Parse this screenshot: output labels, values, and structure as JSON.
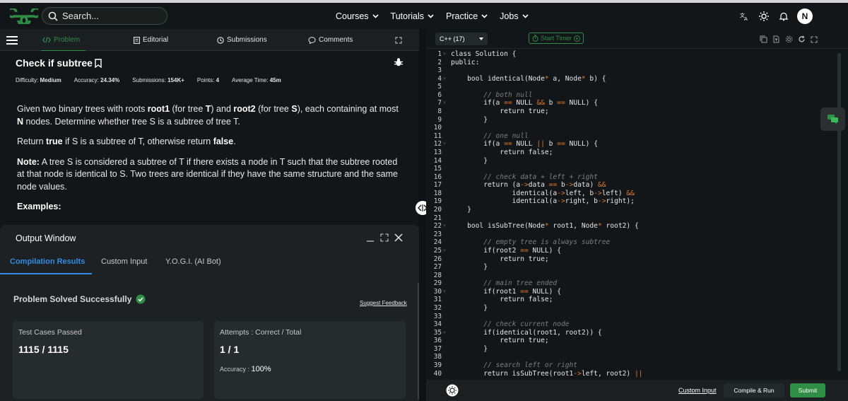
{
  "nav": {
    "search_placeholder": "Search...",
    "links": [
      "Courses",
      "Tutorials",
      "Practice",
      "Jobs"
    ],
    "avatar_initial": "N",
    "brand_color": "#2f8d46"
  },
  "tabs": [
    "Problem",
    "Editorial",
    "Submissions",
    "Comments"
  ],
  "problem": {
    "title": "Check if subtree",
    "meta": {
      "difficulty_label": "Difficulty:",
      "difficulty": "Medium",
      "accuracy_label": "Accuracy:",
      "accuracy": "24.34%",
      "submissions_label": "Submissions:",
      "submissions": "154K+",
      "points_label": "Points:",
      "points": "4",
      "time_label": "Average Time:",
      "time": "45m"
    },
    "para1": {
      "t1": "Given two binary trees with roots ",
      "b1": "root1",
      "t2": " (for tree ",
      "b2": "T",
      "t3": ") and ",
      "b3": "root2",
      "t4": " (for tree ",
      "b4": "S",
      "t5": "), each containing at most ",
      "b5": "N",
      "t6": " nodes. Determine whether tree S is a subtree of tree T."
    },
    "para2": {
      "t1": "Return ",
      "b1": "true",
      "t2": " if S is a subtree of T, otherwise return ",
      "b2": "false",
      "t3": "."
    },
    "para3": {
      "b1": "Note:",
      "t1": " A tree S is considered a subtree of T if there exists a node in T such that the subtree rooted at that node is identical to S. Two trees are identical if they have the same structure and the same node values."
    },
    "examples_label": "Examples:"
  },
  "output": {
    "title": "Output Window",
    "tabs": [
      "Compilation Results",
      "Custom Input",
      "Y.O.G.I. (AI Bot)"
    ],
    "status": "Problem Solved Successfully",
    "feedback": "Suggest Feedback",
    "tests_label": "Test Cases Passed",
    "tests_value": "1115 / 1115",
    "attempts_label": "Attempts : Correct / Total",
    "attempts_value": "1 / 1",
    "accuracy_label": "Accuracy :",
    "accuracy_value": "100%"
  },
  "editor": {
    "language": "C++ (17)",
    "timer_label": "Start Timer",
    "lines": [
      "class Solution {",
      "public:",
      "",
      "    bool identical(Node* a, Node* b) {",
      "",
      "        // both null",
      "        if(a == NULL && b == NULL) {",
      "            return true;",
      "        }",
      "",
      "        // one null",
      "        if(a == NULL || b == NULL) {",
      "            return false;",
      "        }",
      "",
      "        // check data + left + right",
      "        return (a->data == b->data) &&",
      "               identical(a->left, b->left) &&",
      "               identical(a->right, b->right);",
      "    }",
      "",
      "    bool isSubTree(Node* root1, Node* root2) {",
      "",
      "        // empty tree is always subtree",
      "        if(root2 == NULL) {",
      "            return true;",
      "        }",
      "",
      "        // main tree ended",
      "        if(root1 == NULL) {",
      "            return false;",
      "        }",
      "",
      "        // check current node",
      "        if(identical(root1, root2)) {",
      "            return true;",
      "        }",
      "",
      "        // search left or right",
      "        return isSubTree(root1->left, root2) ||"
    ],
    "fold_lines": [
      1,
      4,
      7,
      12,
      22,
      25,
      30,
      35
    ]
  },
  "footer": {
    "custom_input": "Custom Input",
    "compile_run": "Compile & Run",
    "submit": "Submit"
  }
}
